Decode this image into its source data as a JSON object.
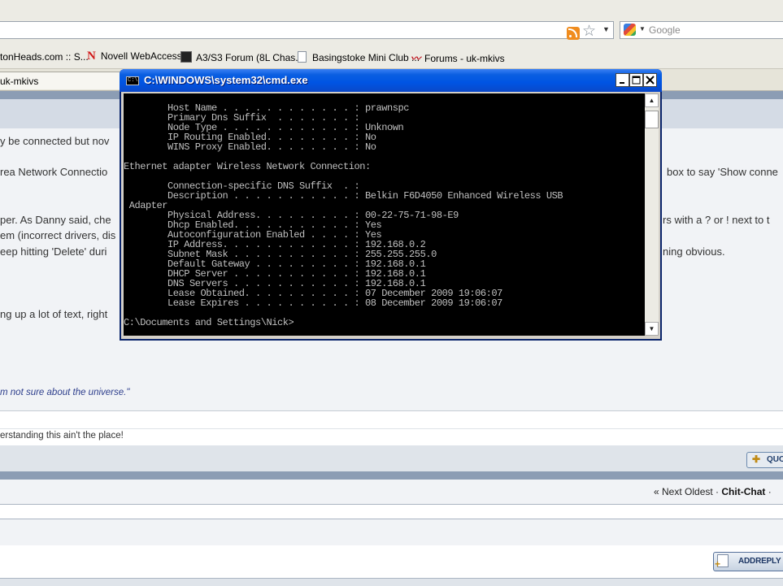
{
  "browser": {
    "search_placeholder": "Google",
    "bookmarks": [
      "tonHeads.com :: S...",
      "Novell WebAccess",
      "A3/S3 Forum (8L Chas...",
      "Basingstoke Mini Club ...",
      "Forums - uk-mkivs"
    ],
    "tab_label": "uk-mkivs"
  },
  "forum": {
    "post_lines": [
      "y be connected but nov",
      "rea Network Connectio",
      "box to say 'Show conne",
      "per. As Danny said, che",
      "rs with a ? or ! next to t",
      "em (incorrect drivers, dis",
      "eep hitting 'Delete' duri",
      "ning obvious.",
      "ng up a lot of text, right"
    ],
    "signature": "m not sure about the universe.\"",
    "signature2": "erstanding this ain't the place!",
    "quote_label": "QUO",
    "nav_prefix": "« Next Oldest · ",
    "nav_section": "Chit-Chat",
    "nav_suffix": " ·",
    "add_reply_label": "ADDREPLY"
  },
  "cmd_window": {
    "title": "C:\\WINDOWS\\system32\\cmd.exe",
    "icon_text": "C:\\",
    "output_lines": [
      "        Host Name . . . . . . . . . . . . : prawnspc",
      "        Primary Dns Suffix  . . . . . . . :",
      "        Node Type . . . . . . . . . . . . : Unknown",
      "        IP Routing Enabled. . . . . . . . : No",
      "        WINS Proxy Enabled. . . . . . . . : No",
      "",
      "Ethernet adapter Wireless Network Connection:",
      "",
      "        Connection-specific DNS Suffix  . :",
      "        Description . . . . . . . . . . . : Belkin F6D4050 Enhanced Wireless USB",
      " Adapter",
      "        Physical Address. . . . . . . . . : 00-22-75-71-98-E9",
      "        Dhcp Enabled. . . . . . . . . . . : Yes",
      "        Autoconfiguration Enabled . . . . : Yes",
      "        IP Address. . . . . . . . . . . . : 192.168.0.2",
      "        Subnet Mask . . . . . . . . . . . : 255.255.255.0",
      "        Default Gateway . . . . . . . . . : 192.168.0.1",
      "        DHCP Server . . . . . . . . . . . : 192.168.0.1",
      "        DNS Servers . . . . . . . . . . . : 192.168.0.1",
      "        Lease Obtained. . . . . . . . . . : 07 December 2009 19:06:07",
      "        Lease Expires . . . . . . . . . . : 08 December 2009 19:06:07",
      "",
      "C:\\Documents and Settings\\Nick>"
    ]
  }
}
